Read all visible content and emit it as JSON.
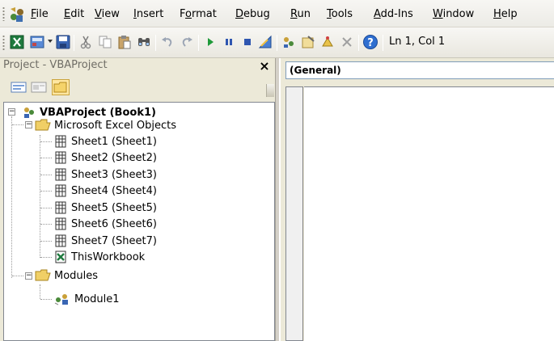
{
  "menubar": {
    "items": [
      {
        "label": "File",
        "accel": "F",
        "rest": "ile"
      },
      {
        "label": "Edit",
        "accel": "E",
        "rest": "dit"
      },
      {
        "label": "View",
        "accel": "V",
        "rest": "iew"
      },
      {
        "label": "Insert",
        "accel": "I",
        "rest": "nsert"
      },
      {
        "label": "Format",
        "pre": "F",
        "accel": "o",
        "rest": "rmat"
      },
      {
        "label": "Debug",
        "accel": "D",
        "rest": "ebug"
      },
      {
        "label": "Run",
        "accel": "R",
        "rest": "un"
      },
      {
        "label": "Tools",
        "accel": "T",
        "rest": "ools"
      },
      {
        "label": "Add-Ins",
        "accel": "A",
        "rest": "dd-Ins"
      },
      {
        "label": "Window",
        "accel": "W",
        "rest": "indow"
      },
      {
        "label": "Help",
        "accel": "H",
        "rest": "elp"
      }
    ]
  },
  "toolbar": {
    "buttons": [
      "view-excel",
      "insert-module",
      "save",
      "cut",
      "copy",
      "paste",
      "find",
      "undo",
      "redo",
      "run",
      "break",
      "reset",
      "design-mode",
      "project-explorer",
      "properties-window",
      "object-browser",
      "toolbox",
      "help"
    ],
    "status": "Ln 1, Col 1"
  },
  "project": {
    "title": "Project - VBAProject",
    "close_label": "×",
    "tree": {
      "root": "VBAProject (Book1)",
      "folder1": "Microsoft Excel Objects",
      "sheets": [
        "Sheet1 (Sheet1)",
        "Sheet2 (Sheet2)",
        "Sheet3 (Sheet3)",
        "Sheet4 (Sheet4)",
        "Sheet5 (Sheet5)",
        "Sheet6 (Sheet6)",
        "Sheet7 (Sheet7)"
      ],
      "workbook": "ThisWorkbook",
      "folder2": "Modules",
      "module": "Module1"
    }
  },
  "code": {
    "object_dropdown": "(General)"
  }
}
